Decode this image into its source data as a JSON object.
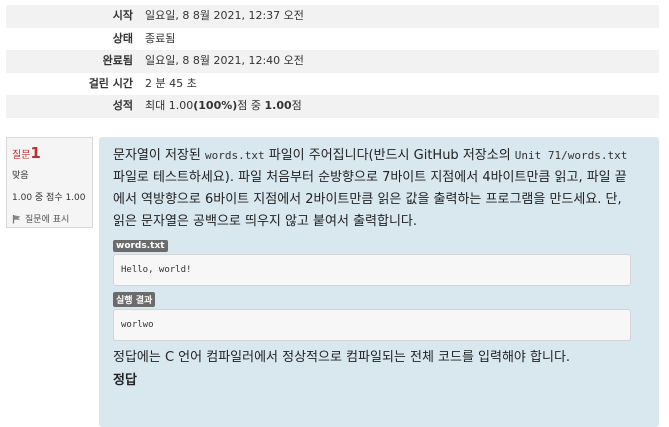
{
  "summary": {
    "rows": [
      {
        "label": "시작",
        "value": "일요일, 8 8월 2021, 12:37 오전"
      },
      {
        "label": "상태",
        "value": "종료됨"
      },
      {
        "label": "완료됨",
        "value": "일요일, 8 8월 2021, 12:40 오전"
      },
      {
        "label": "걸린 시간",
        "value": "2 분 45 초"
      }
    ],
    "grade": {
      "label": "성적",
      "prefix": "최대 ",
      "max": "1.00",
      "percent": "(100%)",
      "middle": "점 중 ",
      "score": "1.00",
      "suffix": "점"
    }
  },
  "question_info": {
    "prefix": "질문",
    "number": "1",
    "state": "맞음",
    "grade": "1.00 중 점수 1.00",
    "flag_label": "질문에 표시"
  },
  "question": {
    "p1_a": "문자열이 저장된 ",
    "p1_code1": "words.txt",
    "p1_b": " 파일이 주어집니다(반드시 GitHub 저장소의 ",
    "p1_code2": "Unit 71/words.txt",
    "p1_c": " 파일로 테스트하세요). 파일 처음부터 순방향으로 7바이트 지점에서 4바이트만큼 읽고, 파일 끝에서 역방향으로 6바이트 지점에서 2바이트만큼 읽은 값을 출력하는 프로그램을 만드세요. 단, 읽은 문자열은 공백으로 띄우지 않고 붙여서 출력합니다.",
    "file_tag": "words.txt",
    "file_content": "Hello, world!",
    "result_tag": "실행 결과",
    "result_content": "worlwo",
    "note": "정답에는 C 언어 컴파일러에서 정상적으로 컴파일되는 전체 코드를 입력해야 합니다.",
    "answer_heading": "정답"
  }
}
